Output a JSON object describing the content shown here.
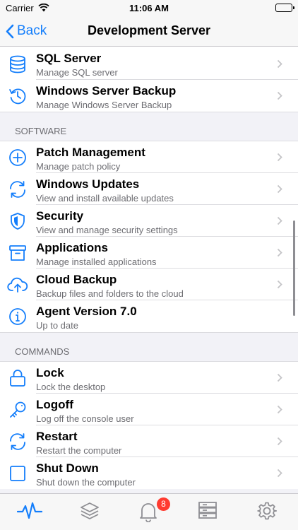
{
  "status_bar": {
    "carrier": "Carrier",
    "time": "11:06 AM"
  },
  "nav": {
    "back_label": "Back",
    "title": "Development Server"
  },
  "colors": {
    "accent": "#147efb",
    "badge": "#ff3b30",
    "subtitle": "#6d6d72"
  },
  "top_rows": [
    {
      "title": "SQL Server",
      "subtitle": "Manage SQL server",
      "icon": "database-icon"
    },
    {
      "title": "Windows Server Backup",
      "subtitle": "Manage Windows Server Backup",
      "icon": "history-icon"
    }
  ],
  "software": {
    "header": "SOFTWARE",
    "rows": [
      {
        "title": "Patch Management",
        "subtitle": "Manage patch policy",
        "icon": "plus-circle-icon"
      },
      {
        "title": "Windows Updates",
        "subtitle": "View and install available updates",
        "icon": "refresh-icon"
      },
      {
        "title": "Security",
        "subtitle": "View and manage security settings",
        "icon": "shield-icon"
      },
      {
        "title": "Applications",
        "subtitle": "Manage installed applications",
        "icon": "archive-box-icon"
      },
      {
        "title": "Cloud Backup",
        "subtitle": "Backup files and folders to the cloud",
        "icon": "cloud-upload-icon"
      },
      {
        "title": "Agent Version 7.0",
        "subtitle": "Up to date",
        "icon": "info-icon"
      }
    ]
  },
  "commands": {
    "header": "COMMANDS",
    "rows": [
      {
        "title": "Lock",
        "subtitle": "Lock the desktop",
        "icon": "lock-icon"
      },
      {
        "title": "Logoff",
        "subtitle": "Log off the console user",
        "icon": "key-icon"
      },
      {
        "title": "Restart",
        "subtitle": "Restart the computer",
        "icon": "restart-icon"
      },
      {
        "title": "Shut Down",
        "subtitle": "Shut down the computer",
        "icon": "stop-square-icon"
      }
    ]
  },
  "tab_bar": {
    "tabs": [
      {
        "name": "activity",
        "icon": "pulse-icon",
        "active": true
      },
      {
        "name": "layers",
        "icon": "layers-icon",
        "active": false
      },
      {
        "name": "alerts",
        "icon": "bell-icon",
        "active": false
      },
      {
        "name": "servers",
        "icon": "server-rack-icon",
        "active": false
      },
      {
        "name": "settings",
        "icon": "gear-icon",
        "active": false
      }
    ],
    "alert_badge": "8"
  }
}
